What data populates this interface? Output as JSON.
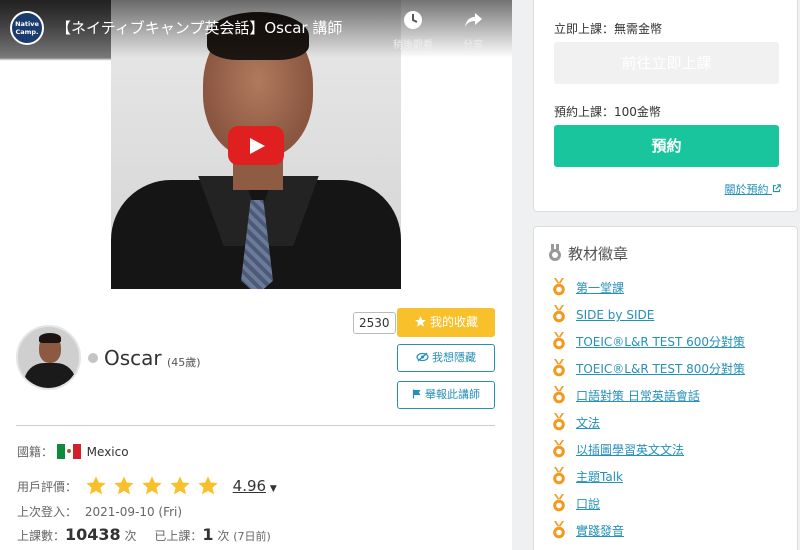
{
  "video": {
    "channel_logo": "Native Camp.",
    "title": "【ネイティブキャンプ英会話】Oscar 講師",
    "watch_later": "稍後觀看",
    "share": "分享",
    "brand": "YouTube"
  },
  "profile": {
    "favorite_count": "2530",
    "favorite_label": "我的收藏",
    "hide_label": "我想隱藏",
    "report_label": "舉報此講師",
    "name": "Oscar",
    "age": "(45歲)"
  },
  "info": {
    "nationality_label": "國籍：",
    "nationality": "Mexico",
    "rating_label": "用戶評價：",
    "rating": "4.96",
    "rating_stars": 5,
    "last_login_label": "上次登入：",
    "last_login": "2021-09-10 (Fri)",
    "lessons_label": "上課數：",
    "lessons_count": "10438",
    "lessons_unit": "次",
    "taken_label": "已上課：",
    "taken_count": "1",
    "taken_unit": "次",
    "taken_ago": "(7日前)"
  },
  "booking": {
    "instant_label": "立即上課：無需金幣",
    "instant_button": "前往立即上課",
    "reserve_label": "預約上課：100金幣",
    "reserve_button": "預約",
    "about_link": "關於預約"
  },
  "badges": {
    "title": "教材徽章",
    "items": [
      "第一堂課",
      "SIDE by SIDE",
      "TOEIC®L&R TEST 600分對策",
      "TOEIC®L&R TEST 800分對策",
      "口語對策 日常英語會話",
      "文法",
      "以插圖學習英文文法",
      "主題Talk",
      "口說",
      "實踐發音"
    ]
  },
  "colors": {
    "favorite": "#f8c02b",
    "reserve": "#18c59d",
    "link": "#2590b8",
    "medal": "#f39a1e"
  }
}
